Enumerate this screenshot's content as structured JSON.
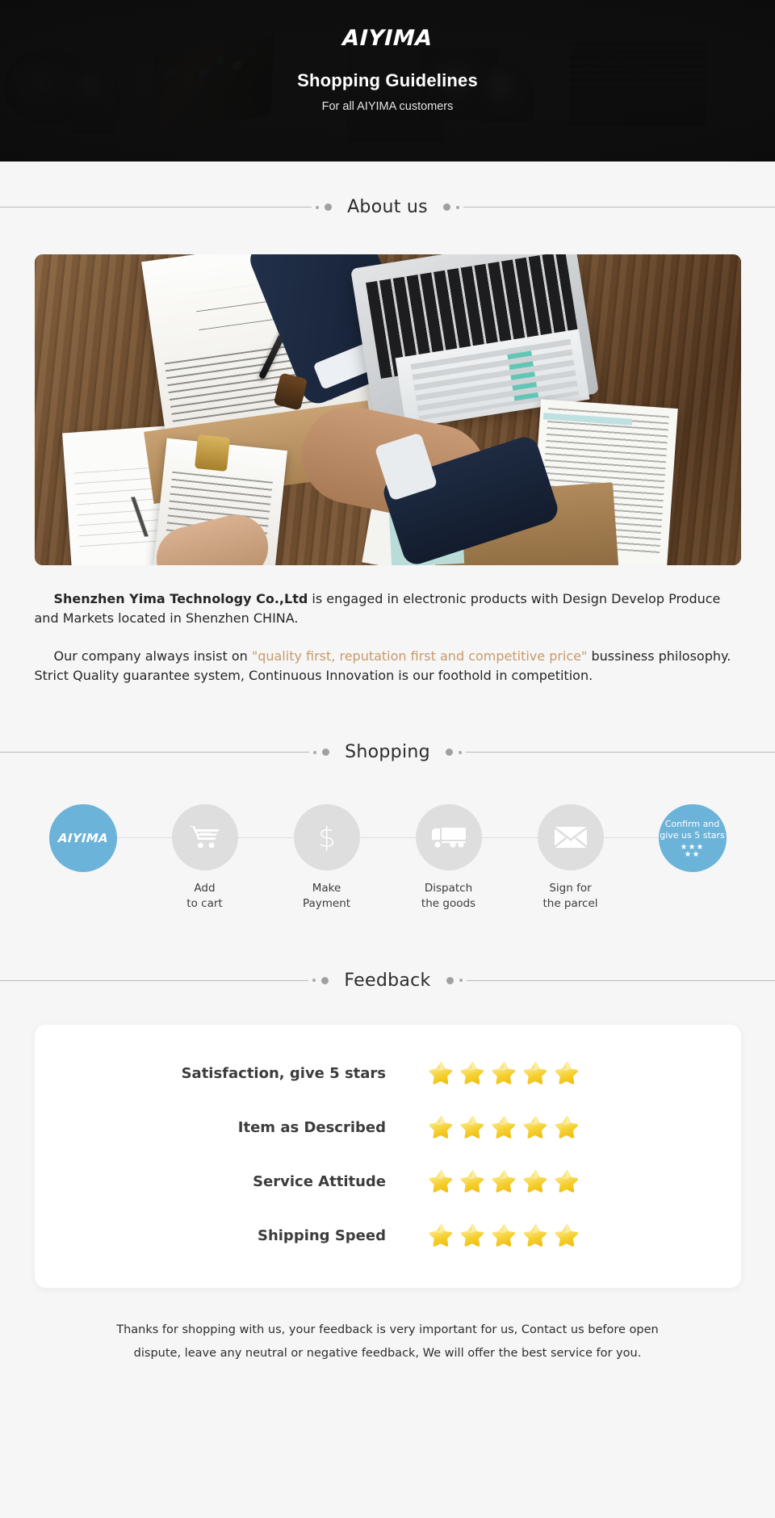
{
  "hero": {
    "brand": "AIYIMA",
    "title": "Shopping Guidelines",
    "subtitle": "For all AIYIMA customers"
  },
  "sections": {
    "about": {
      "title": "About us"
    },
    "shopping": {
      "title": "Shopping"
    },
    "feedback": {
      "title": "Feedback"
    }
  },
  "about": {
    "paragraph1_company": "Shenzhen Yima Technology Co.,Ltd",
    "paragraph1_rest": " is engaged in electronic products with Design Develop Produce and Markets located in Shenzhen CHINA.",
    "paragraph2_lead": "Our company always insist on ",
    "paragraph2_quote": "\"quality first, reputation first and competitive price\"",
    "paragraph2_rest": " bussiness philosophy. Strict Quality guarantee system, Continuous Innovation is our foothold in competition.",
    "quote_color": "#c79a6a"
  },
  "shopping": {
    "accent_color": "#6cb3d9",
    "circle_color": "#dedede",
    "steps": [
      {
        "icon": "aiyima-logo-icon",
        "logo": "AIYIMA",
        "label": ""
      },
      {
        "icon": "shopping-cart-icon",
        "label": "Add\nto cart"
      },
      {
        "icon": "dollar-sign-icon",
        "label": "Make\nPayment"
      },
      {
        "icon": "delivery-truck-icon",
        "label": "Dispatch\nthe goods"
      },
      {
        "icon": "envelope-icon",
        "label": "Sign for\nthe parcel"
      },
      {
        "icon": "five-stars-icon",
        "confirm_line1": "Confirm and",
        "confirm_line2": "give us 5 stars",
        "stars_top": "★★★",
        "stars_bottom": "★★",
        "label": ""
      }
    ]
  },
  "feedback": {
    "rows": [
      {
        "label": "Satisfaction, give 5 stars",
        "stars": 5
      },
      {
        "label": "Item as Described",
        "stars": 5
      },
      {
        "label": "Service Attitude",
        "stars": 5
      },
      {
        "label": "Shipping Speed",
        "stars": 5
      }
    ],
    "star_color": "#f5d544"
  },
  "footer": {
    "line1": "Thanks for shopping with us, your feedback is very important for us, Contact us before open",
    "line2": "dispute, leave any neutral or negative feedback, We will offer the best service for you."
  }
}
